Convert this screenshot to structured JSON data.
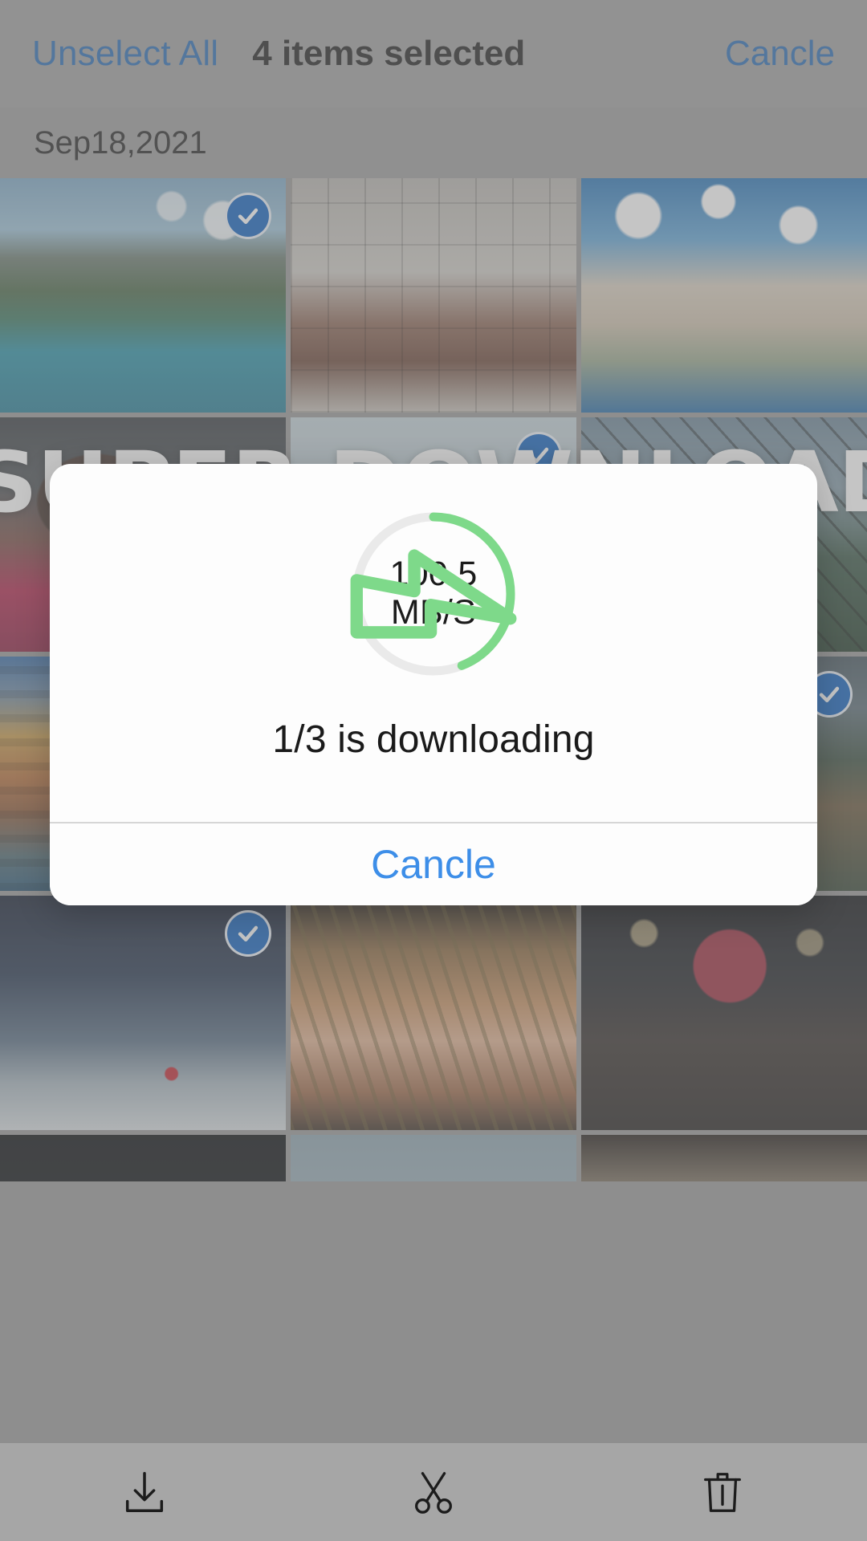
{
  "topbar": {
    "unselect_all_label": "Unselect All",
    "selection_count_label": "4 items selected",
    "cancel_label": "Cancle"
  },
  "date_header": {
    "label": "Sep18,2021"
  },
  "watermark": {
    "text": "SUPER DOWNLOAD"
  },
  "gallery": {
    "photos": [
      {
        "id": "p1",
        "art": "ph-mountain",
        "selected": true,
        "alt": "mountain lake"
      },
      {
        "id": "p2",
        "art": "ph-bw",
        "selected": false,
        "alt": "black and white portrait by window"
      },
      {
        "id": "p3",
        "art": "ph-santorini",
        "selected": false,
        "alt": "santorini coastline"
      },
      {
        "id": "p4",
        "art": "ph-portrait1",
        "selected": false,
        "alt": "portrait in pink top"
      },
      {
        "id": "p5",
        "art": "ph-lightsky",
        "selected": true,
        "alt": "pale sky scene"
      },
      {
        "id": "p6",
        "art": "ph-branches",
        "selected": false,
        "alt": "branches against sky"
      },
      {
        "id": "p7",
        "art": "ph-cinque",
        "selected": false,
        "alt": "colourful coastal town"
      },
      {
        "id": "p8",
        "art": "ph-dark",
        "selected": false,
        "alt": "dark scene"
      },
      {
        "id": "p9",
        "art": "ph-cabin",
        "selected": true,
        "alt": "mountain cabin"
      },
      {
        "id": "p10",
        "art": "ph-flag",
        "selected": true,
        "alt": "flag above clouds"
      },
      {
        "id": "p11",
        "art": "ph-curly",
        "selected": false,
        "alt": "woman with curly hair"
      },
      {
        "id": "p12",
        "art": "ph-beret",
        "selected": false,
        "alt": "woman with red beret"
      },
      {
        "id": "p13",
        "art": "ph-strip-dark",
        "selected": false,
        "alt": "dark strip"
      },
      {
        "id": "p14",
        "art": "ph-strip-sky",
        "selected": false,
        "alt": "sky strip"
      },
      {
        "id": "p15",
        "art": "ph-strip-desk",
        "selected": false,
        "alt": "desk strip"
      }
    ]
  },
  "download_dialog": {
    "speed_value": "100.5",
    "speed_unit": "MB/S",
    "status_text": "1/3 is downloading",
    "cancel_label": "Cancle",
    "progress_percent": 44,
    "ring_progress_color": "#7ed98a",
    "ring_track_color": "#eaeaea",
    "bolt_icon": "lightning-bolt-icon"
  },
  "bottombar": {
    "actions": [
      {
        "name": "download-button",
        "icon": "download-icon"
      },
      {
        "name": "cut-button",
        "icon": "scissors-icon"
      },
      {
        "name": "delete-button",
        "icon": "trash-icon"
      }
    ]
  },
  "colors": {
    "accent_blue": "#2f6fb5",
    "dialog_blue": "#3d8ee8",
    "check_badge_blue": "#1565c0",
    "progress_green": "#7ed98a",
    "bar_grey": "#a2a2a2"
  }
}
